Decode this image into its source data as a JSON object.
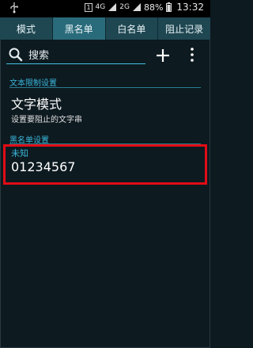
{
  "status_bar": {
    "usb_icon": "usb-icon",
    "sim_number": "1",
    "network_1": "4G",
    "network_2": "2G",
    "battery_percent": "88%",
    "time": "13:32"
  },
  "tabs": [
    {
      "label": "模式",
      "active": false
    },
    {
      "label": "黑名单",
      "active": true
    },
    {
      "label": "白名单",
      "active": false
    },
    {
      "label": "阻止记录",
      "active": false
    }
  ],
  "search": {
    "placeholder": "搜索",
    "icon": "search-icon"
  },
  "toolbar": {
    "add_icon": "plus-icon",
    "more_icon": "more-vertical-icon"
  },
  "text_filter_section": {
    "title": "文本限制设置",
    "item_title": "文字模式",
    "item_subtitle": "设置要阻止的文字串"
  },
  "blacklist_section": {
    "title": "黑名单设置",
    "entries": [
      {
        "name": "未知",
        "number": "01234567"
      }
    ]
  },
  "colors": {
    "accent": "#3ab6d9",
    "tab_bg": "#1f4752",
    "tab_active_bg": "#2a6b7b",
    "highlight_border": "#e10c15",
    "background": "#0d1a20"
  }
}
